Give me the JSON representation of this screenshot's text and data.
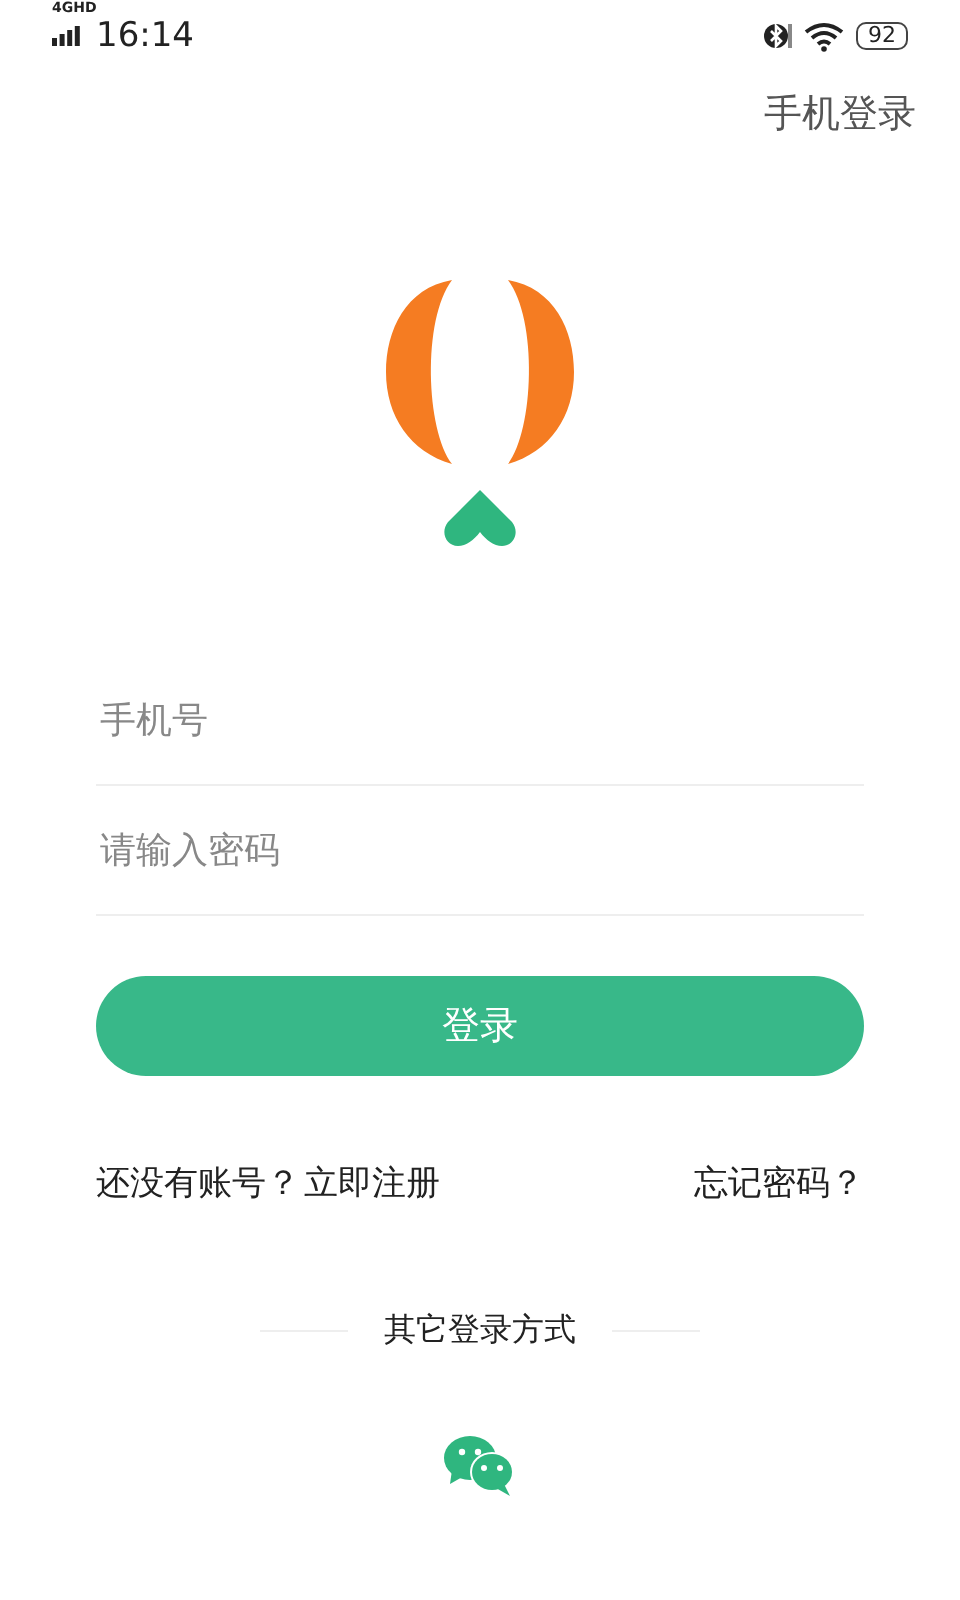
{
  "status_bar": {
    "network": "4GHD",
    "time": "16:14",
    "battery": "92"
  },
  "top_link": "手机登录",
  "fields": [
    {
      "placeholder": "手机号"
    },
    {
      "placeholder": "请输入密码"
    }
  ],
  "login_button": "登录",
  "register_prompt": "还没有账号？",
  "register_link": "立即注册",
  "forgot_link": "忘记密码？",
  "other_login_label": "其它登录方式"
}
